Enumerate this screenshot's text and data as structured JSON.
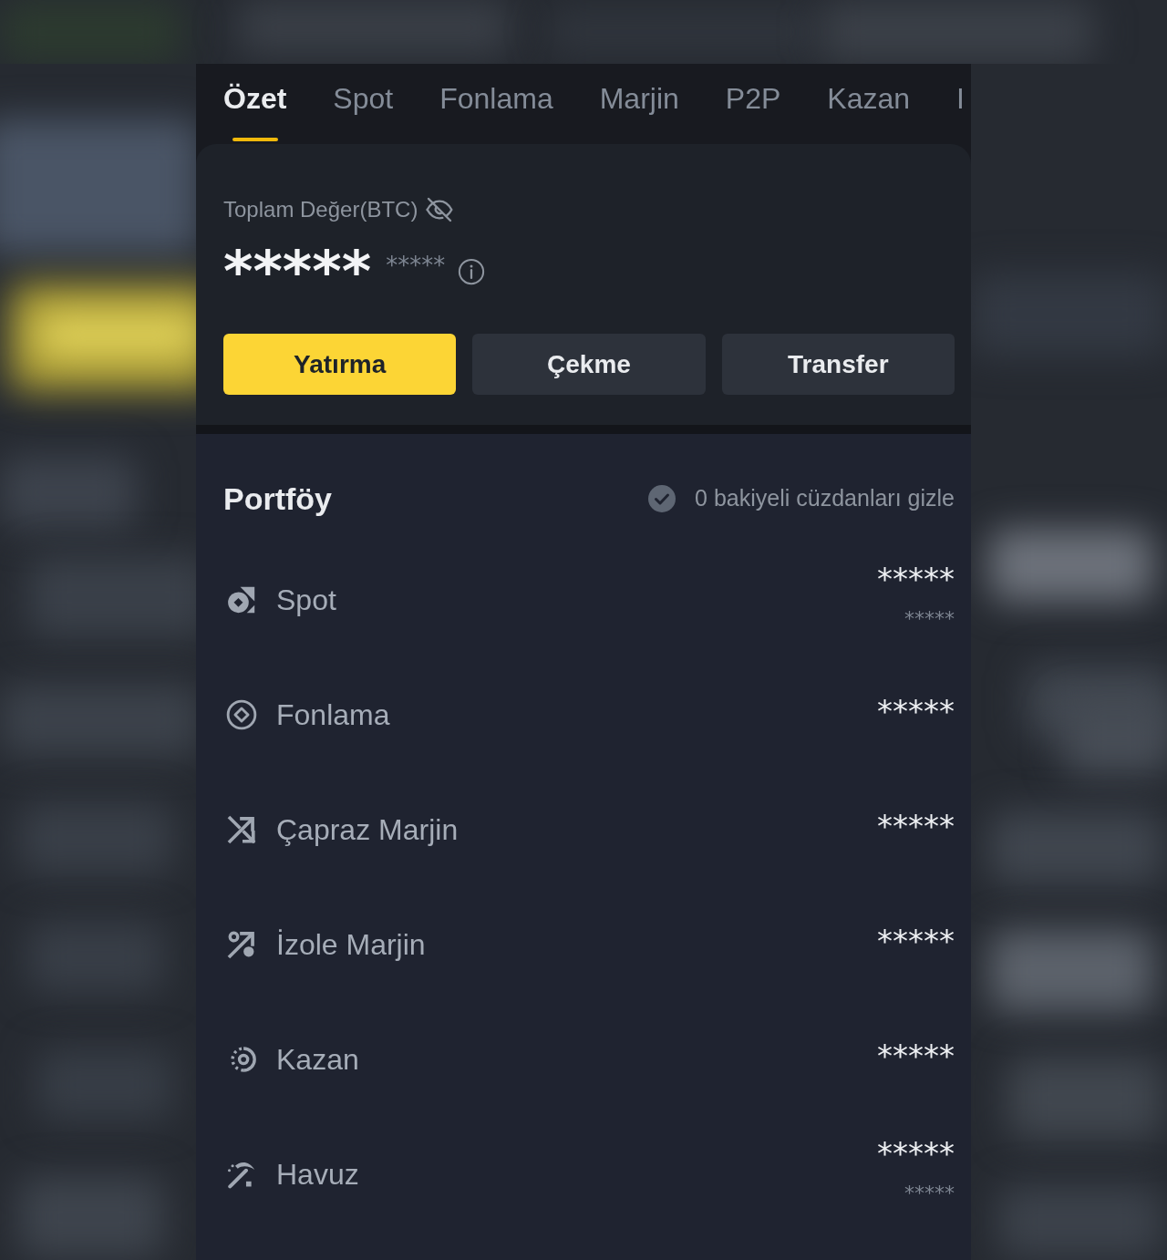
{
  "tabs": [
    {
      "label": "Özet",
      "selected": true
    },
    {
      "label": "Spot",
      "selected": false
    },
    {
      "label": "Fonlama",
      "selected": false
    },
    {
      "label": "Marjin",
      "selected": false
    },
    {
      "label": "P2P",
      "selected": false
    },
    {
      "label": "Kazan",
      "selected": false
    },
    {
      "label": "I",
      "selected": false
    }
  ],
  "balance": {
    "label": "Toplam Değer(BTC)",
    "value": "*****",
    "secondary_value": "*****"
  },
  "buttons": [
    {
      "label": "Yatırma",
      "kind": "primary"
    },
    {
      "label": "Çekme",
      "kind": "secondary"
    },
    {
      "label": "Transfer",
      "kind": "secondary"
    }
  ],
  "portfolio": {
    "title": "Portföy",
    "hide_zero_balances": {
      "label": "0 bakiyeli cüzdanları gizle",
      "checked": true
    },
    "accounts": [
      {
        "name": "Spot",
        "value": "*****",
        "secondary_value": "*****"
      },
      {
        "name": "Fonlama",
        "value": "*****"
      },
      {
        "name": "Çapraz Marjin",
        "value": "*****"
      },
      {
        "name": "İzole Marjin",
        "value": "*****"
      },
      {
        "name": "Kazan",
        "value": "*****"
      },
      {
        "name": "Havuz",
        "value": "*****",
        "secondary_value": "*****"
      }
    ]
  }
}
